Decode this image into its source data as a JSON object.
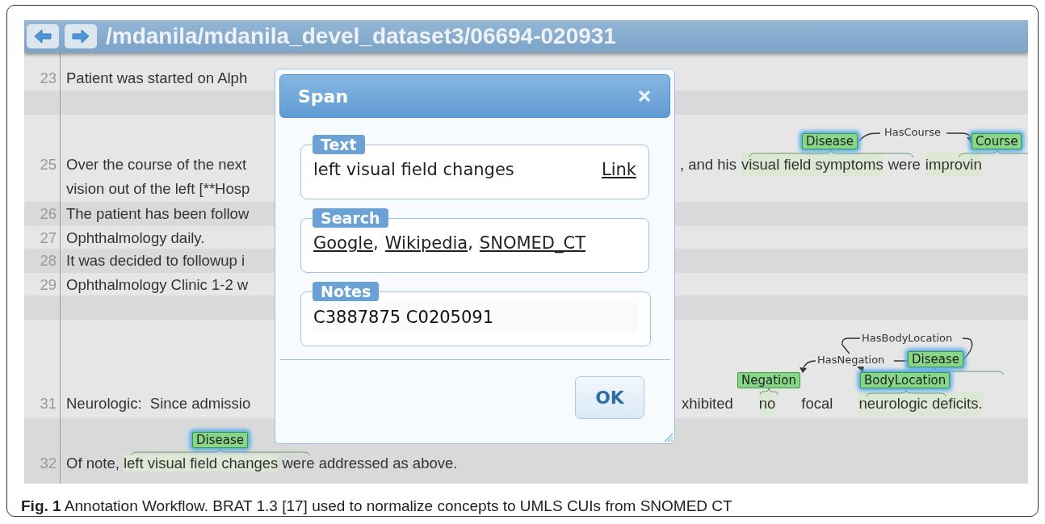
{
  "toolbar": {
    "path": "/mdanila/mdanila_devel_dataset3/06694-020931"
  },
  "lines": [
    {
      "kind": "blank"
    },
    {
      "kind": "text",
      "number": "23",
      "segments": [
        {
          "text": "Patient was started on Alph",
          "marked": false
        }
      ]
    },
    {
      "kind": "blank"
    },
    {
      "kind": "annotated",
      "number": "25",
      "segments": [
        {
          "text": "Over the course of the next",
          "marked": false
        }
      ],
      "continuation": "vision out of the left [**Hosp",
      "right_segments": [
        {
          "text": ", and his",
          "marked": false
        },
        {
          "text": "visual field symptoms",
          "marked": true
        },
        {
          "text": "were",
          "marked": false
        },
        {
          "text": "improvin",
          "marked": true
        }
      ],
      "annotations": [
        {
          "label": "Disease",
          "highlighted": true
        },
        {
          "label": "Course",
          "highlighted": true
        }
      ],
      "relations": [
        {
          "label": "HasCourse"
        }
      ]
    },
    {
      "kind": "text",
      "number": "26",
      "segments": [
        {
          "text": "The patient has been follow",
          "marked": false
        }
      ]
    },
    {
      "kind": "text",
      "number": "27",
      "segments": [
        {
          "text": "Ophthalmology daily.",
          "marked": false
        }
      ]
    },
    {
      "kind": "text",
      "number": "28",
      "segments": [
        {
          "text": "It was decided to followup i",
          "marked": false
        }
      ]
    },
    {
      "kind": "text",
      "number": "29",
      "segments": [
        {
          "text": "Ophthalmology Clinic 1-2 w",
          "marked": false
        }
      ]
    },
    {
      "kind": "blank"
    },
    {
      "kind": "annotated",
      "number": "31",
      "segments": [
        {
          "text": "Neurologic:  Since admissio",
          "marked": false
        }
      ],
      "right_segments": [
        {
          "text": "xhibited",
          "marked": false
        },
        {
          "text": "no",
          "marked": true
        },
        {
          "text": "focal",
          "marked": false
        },
        {
          "text": "neurologic deficits.",
          "marked": true
        }
      ],
      "annotations": [
        {
          "label": "Negation",
          "highlighted": false
        },
        {
          "label": "Disease",
          "highlighted": true
        },
        {
          "label": "BodyLocation",
          "highlighted": true
        }
      ],
      "relations": [
        {
          "label": "HasBodyLocation"
        },
        {
          "label": "HasNegation"
        }
      ]
    },
    {
      "kind": "annotated",
      "number": "32",
      "segments": [
        {
          "text": "Of note, ",
          "marked": false
        },
        {
          "text": "left visual field changes",
          "marked": true
        },
        {
          "text": " were addressed as above.",
          "marked": false
        }
      ],
      "annotations": [
        {
          "label": "Disease",
          "highlighted": true
        }
      ]
    }
  ],
  "dialog": {
    "title": "Span",
    "sections": [
      {
        "kind": "text",
        "legend": "Text",
        "value": "left visual field changes",
        "link": "Link"
      },
      {
        "kind": "links",
        "legend": "Search",
        "links": [
          "Google",
          "Wikipedia",
          "SNOMED_CT"
        ],
        "separator": ","
      },
      {
        "kind": "input",
        "legend": "Notes",
        "value": "C3887875 C0205091"
      }
    ],
    "button": "OK"
  },
  "caption": "**Fig. 1** Annotation Workflow. BRAT 1.3 [17] used to normalize concepts to UMLS CUIs from SNOMED CT"
}
